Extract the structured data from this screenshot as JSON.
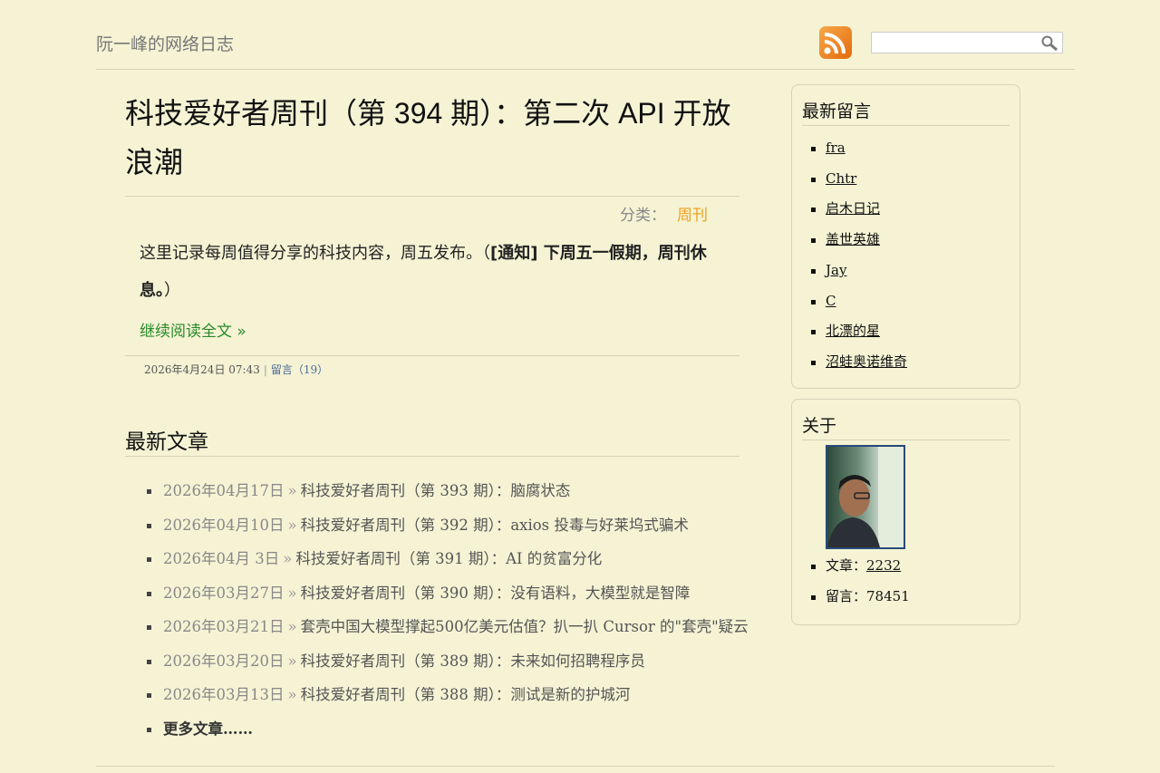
{
  "header": {
    "site_title": "阮一峰的网络日志",
    "search_placeholder": ""
  },
  "post": {
    "title": "科技爱好者周刊（第 394 期）：第二次 API 开放浪潮",
    "category_label": "分类：",
    "category": "周刊",
    "intro_text": "这里记录每周值得分享的科技内容，周五发布。（",
    "intro_bold": "[通知] 下周五一假期，周刊休息。",
    "intro_end": "）",
    "read_more": "继续阅读全文 »",
    "date": "2026年4月24日 07:43",
    "comments": "留言（19）"
  },
  "recent": {
    "title": "最新文章",
    "items": [
      {
        "date": "2026年04月17日",
        "title": "科技爱好者周刊（第 393 期）：脑腐状态"
      },
      {
        "date": "2026年04月10日",
        "title": "科技爱好者周刊（第 392 期）：axios 投毒与好莱坞式骗术"
      },
      {
        "date": "2026年04月 3日",
        "title": "科技爱好者周刊（第 391 期）：AI 的贫富分化"
      },
      {
        "date": "2026年03月27日",
        "title": "科技爱好者周刊（第 390 期）：没有语料，大模型就是智障"
      },
      {
        "date": "2026年03月21日",
        "title": "套壳中国大模型撑起500亿美元估值？扒一扒 Cursor 的\"套壳\"疑云"
      },
      {
        "date": "2026年03月20日",
        "title": "科技爱好者周刊（第 389 期）：未来如何招聘程序员"
      },
      {
        "date": "2026年03月13日",
        "title": "科技爱好者周刊（第 388 期）：测试是新的护城河"
      }
    ],
    "arrow": "»",
    "more": "更多文章……"
  },
  "sidebar": {
    "comments_title": "最新留言",
    "commenters": [
      "fra",
      "Chtr",
      "启木日记",
      "盖世英雄",
      "Jay",
      "C",
      "北漂的星",
      "沼蛙奥诺维奇"
    ],
    "about_title": "关于",
    "articles_label": "文章：",
    "articles_count": "2232",
    "comments_label": "留言：",
    "comments_count": "78451"
  },
  "colors": {
    "background": "#f5f3d4",
    "category_link": "#f0a020",
    "read_more": "#2a8a2a",
    "rss": "#e46b0c"
  }
}
